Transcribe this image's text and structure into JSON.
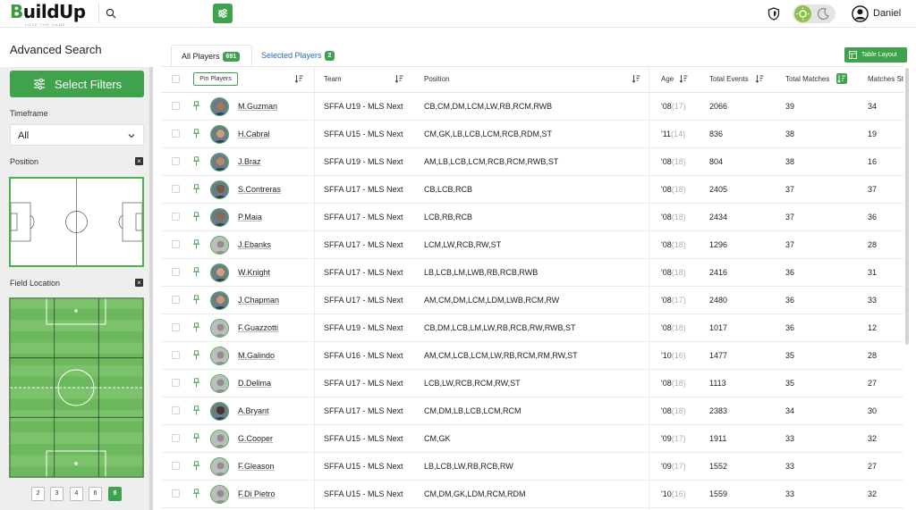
{
  "app": {
    "logo_main": "BuildUp",
    "logo_tagline": "LOVE THE GAME",
    "user_name": "Daniel"
  },
  "search": {
    "placeholder": ""
  },
  "sidebar": {
    "title": "Advanced Search",
    "select_filters_label": "Select Filters",
    "timeframe_label": "Timeframe",
    "timeframe_value": "All",
    "position_label": "Position",
    "field_location_label": "Field Location",
    "zone_buttons": [
      "2",
      "3",
      "4",
      "6",
      "9"
    ],
    "zone_active": "9"
  },
  "tabs": {
    "all_label": "All Players",
    "all_count": "691",
    "selected_label": "Selected Players",
    "selected_count": "2"
  },
  "table_layout_label": "Table Layout",
  "table": {
    "pin_players_label": "Pin Players",
    "headers": {
      "team": "Team",
      "position": "Position",
      "age": "Age",
      "total_events": "Total Events",
      "total_matches": "Total Matches",
      "matches_started": "Matches St"
    },
    "rows": [
      {
        "name": "M.Guzman",
        "team": "SFFA U19 - MLS Next",
        "position": "CB,CM,DM,LCM,LW,RB,RCM,RWB",
        "age": "'08",
        "age_sub": "(17)",
        "events": "2066",
        "matches": "39",
        "started": "34",
        "photo": true,
        "skin": "#a0785a"
      },
      {
        "name": "H.Cabral",
        "team": "SFFA U15 - MLS Next",
        "position": "CM,GK,LB,LCB,LCM,RCB,RDM,ST",
        "age": "'11",
        "age_sub": "(14)",
        "events": "836",
        "matches": "38",
        "started": "19",
        "photo": true,
        "skin": "#c8a07a"
      },
      {
        "name": "J.Braz",
        "team": "SFFA U19 - MLS Next",
        "position": "AM,LB,LCB,LCM,RCB,RCM,RWB,ST",
        "age": "'08",
        "age_sub": "(18)",
        "events": "804",
        "matches": "38",
        "started": "16",
        "photo": true,
        "skin": "#b48a66"
      },
      {
        "name": "S.Contreras",
        "team": "SFFA U17 - MLS Next",
        "position": "CB,LCB,RCB",
        "age": "'08",
        "age_sub": "(18)",
        "events": "2405",
        "matches": "37",
        "started": "37",
        "photo": true,
        "skin": "#7a5a44"
      },
      {
        "name": "P.Maia",
        "team": "SFFA U17 - MLS Next",
        "position": "LCB,RB,RCB",
        "age": "'08",
        "age_sub": "(18)",
        "events": "2434",
        "matches": "37",
        "started": "36",
        "photo": true,
        "skin": "#8a6a52"
      },
      {
        "name": "J.Ebanks",
        "team": "SFFA U17 - MLS Next",
        "position": "LCM,LW,RCB,RW,ST",
        "age": "'08",
        "age_sub": "(18)",
        "events": "1296",
        "matches": "37",
        "started": "28",
        "photo": false,
        "skin": "#9e9e9e"
      },
      {
        "name": "W.Knight",
        "team": "SFFA U17 - MLS Next",
        "position": "LB,LCB,LM,LWB,RB,RCB,RWB",
        "age": "'08",
        "age_sub": "(18)",
        "events": "2416",
        "matches": "36",
        "started": "31",
        "photo": true,
        "skin": "#d0a07a"
      },
      {
        "name": "J.Chapman",
        "team": "SFFA U17 - MLS Next",
        "position": "AM,CM,DM,LCM,LDM,LWB,RCM,RW",
        "age": "'08",
        "age_sub": "(17)",
        "events": "2480",
        "matches": "36",
        "started": "33",
        "photo": true,
        "skin": "#c89a70"
      },
      {
        "name": "F.Guazzotti",
        "team": "SFFA U19 - MLS Next",
        "position": "CB,DM,LCB,LM,LW,RB,RCB,RW,RWB,ST",
        "age": "'08",
        "age_sub": "(18)",
        "events": "1017",
        "matches": "36",
        "started": "12",
        "photo": false,
        "skin": "#9e9e9e"
      },
      {
        "name": "M.Galindo",
        "team": "SFFA U16 - MLS Next",
        "position": "AM,CM,LCB,LCM,LW,RB,RCM,RM,RW,ST",
        "age": "'10",
        "age_sub": "(16)",
        "events": "1477",
        "matches": "35",
        "started": "28",
        "photo": false,
        "skin": "#9e9e9e"
      },
      {
        "name": "D.Delima",
        "team": "SFFA U17 - MLS Next",
        "position": "LCB,LW,RCB,RCM,RW,ST",
        "age": "'08",
        "age_sub": "(18)",
        "events": "1113",
        "matches": "35",
        "started": "27",
        "photo": false,
        "skin": "#9e9e9e"
      },
      {
        "name": "A.Bryant",
        "team": "SFFA U17 - MLS Next",
        "position": "CM,DM,LB,LCB,LCM,RCM",
        "age": "'08",
        "age_sub": "(18)",
        "events": "2383",
        "matches": "34",
        "started": "30",
        "photo": true,
        "skin": "#4a3428"
      },
      {
        "name": "G.Cooper",
        "team": "SFFA U15 - MLS Next",
        "position": "CM,GK",
        "age": "'09",
        "age_sub": "(17)",
        "events": "1911",
        "matches": "33",
        "started": "32",
        "photo": false,
        "skin": "#9e9e9e"
      },
      {
        "name": "F.Gleason",
        "team": "SFFA U15 - MLS Next",
        "position": "LB,LCB,LW,RB,RCB,RW",
        "age": "'09",
        "age_sub": "(17)",
        "events": "1552",
        "matches": "33",
        "started": "27",
        "photo": false,
        "skin": "#9e9e9e"
      },
      {
        "name": "F.Di Pietro",
        "team": "SFFA U15 - MLS Next",
        "position": "CM,DM,GK,LDM,RCM,RDM",
        "age": "'10",
        "age_sub": "(16)",
        "events": "1559",
        "matches": "33",
        "started": "32",
        "photo": false,
        "skin": "#9e9e9e"
      }
    ]
  },
  "colors": {
    "brand_green": "#3fa34d",
    "link_blue": "#2b6cb0",
    "pitch_light": "#7cc26c",
    "pitch_dark": "#6cb85d"
  },
  "icons": [
    "search-icon",
    "filter-sliders-icon",
    "shield-icon",
    "sun-icon",
    "moon-icon",
    "user-avatar-icon",
    "chevron-down-icon",
    "close-icon",
    "pin-icon",
    "sort-icon",
    "table-layout-icon"
  ]
}
